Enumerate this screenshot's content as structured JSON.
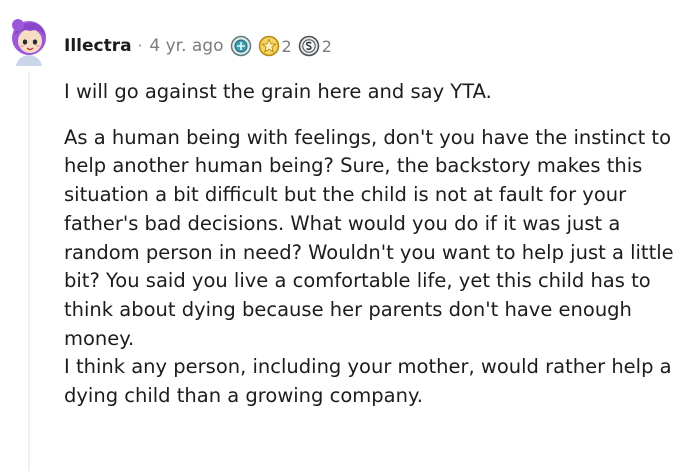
{
  "comment": {
    "author": "Illectra",
    "separator": "·",
    "age": "4 yr. ago",
    "awards": [
      {
        "icon": "helpful-award-icon",
        "count": ""
      },
      {
        "icon": "wholesome-award-icon",
        "count": "2"
      },
      {
        "icon": "silver-award-icon",
        "count": "2"
      }
    ],
    "paragraphs": [
      "I will go against the grain here and say YTA.",
      "As a human being with feelings, don't you have the instinct to help another human being? Sure, the backstory makes this situation a bit difficult but the child is not at fault for your father's bad decisions. What would you do if it was just a random person in need? Wouldn't you want to help just a little bit? You said you live a comfortable life, yet this child has to think about dying because her parents don't have enough money.",
      "I think any person, including your mother, would rather help a dying child than a growing company."
    ]
  },
  "colors": {
    "text": "#1c1c1c",
    "meta": "#7c7c7c",
    "avatar_hair": "#9b59d9",
    "avatar_skin": "#f7dcc4",
    "thread_line": "#edeff1"
  }
}
